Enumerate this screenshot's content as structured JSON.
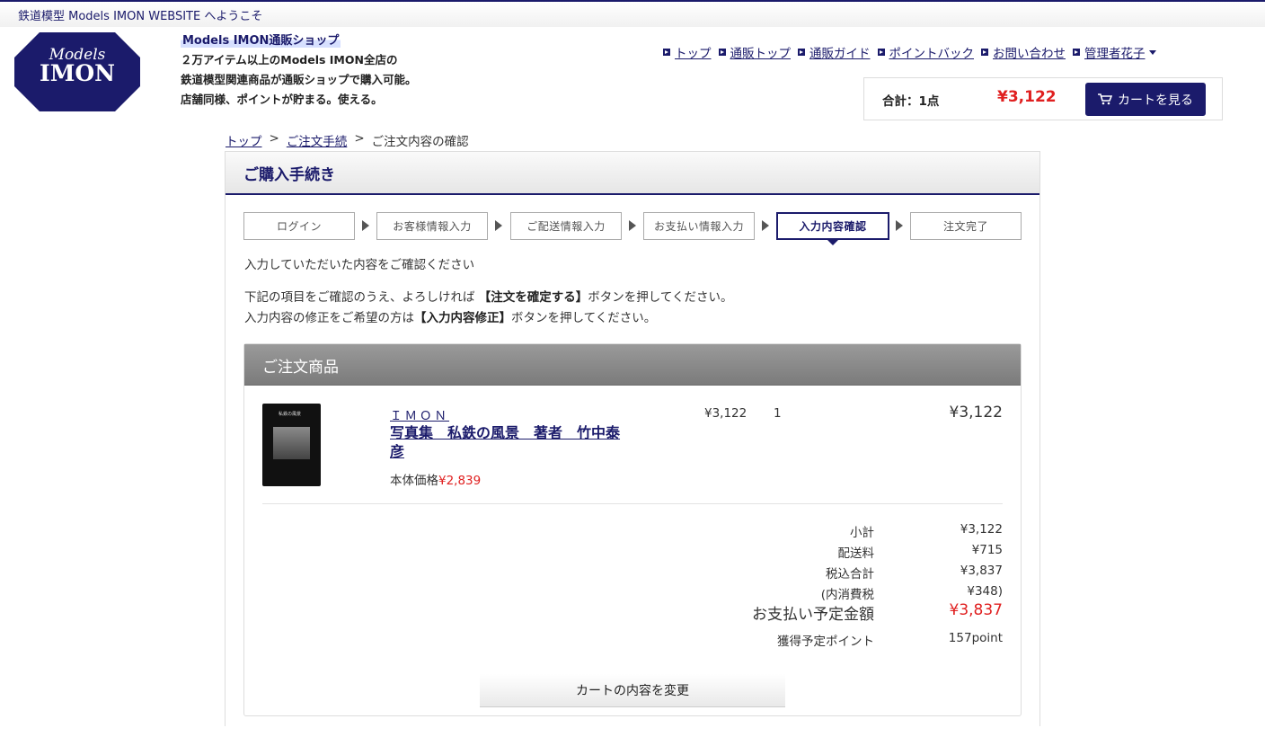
{
  "welcome": "鉄道模型 Models IMON WEBSITE へようこそ",
  "logo": {
    "top": "Models",
    "bottom": "IMON"
  },
  "shop": {
    "title": "Models IMON通販ショップ",
    "desc1": "２万アイテム以上のModels IMON全店の",
    "desc2": "鉄道模型関連商品が通販ショップで購入可能。",
    "desc3": "店舗同様、ポイントが貯まる。使える。"
  },
  "nav": [
    "トップ",
    "通販トップ",
    "通販ガイド",
    "ポイントバック",
    "お問い合わせ",
    "管理者花子"
  ],
  "cart": {
    "total_label": "合計：1点",
    "total_price": "¥3,122",
    "button": "カートを見る"
  },
  "breadcrumb": [
    "トップ",
    "ご注文手続",
    "ご注文内容の確認"
  ],
  "panel_title": "ご購入手続き",
  "steps": [
    "ログイン",
    "お客様情報入力",
    "ご配送情報入力",
    "お支払い情報入力",
    "入力内容確認",
    "注文完了"
  ],
  "messages": {
    "confirm": "入力していただいた内容をご確認ください",
    "line1_pre": "下記の項目をご確認のうえ、よろしければ ",
    "line1_bold": "【注文を確定する】",
    "line1_post": "ボタンを押してください。",
    "line2_pre": "入力内容の修正をご希望の方は",
    "line2_bold": "【入力内容修正】",
    "line2_post": "ボタンを押してください。"
  },
  "order": {
    "title": "ご注文商品",
    "brand": "ＩＭＯＮ",
    "product_name": "写真集　私鉄の風景　著者　竹中泰彦",
    "base_label": "本体価格",
    "base_price": "¥2,839",
    "unit_price": "¥3,122",
    "quantity": "1",
    "line_total": "¥3,122",
    "thumb_title": "私鉄の風景"
  },
  "summary": {
    "subtotal_label": "小計",
    "subtotal": "¥3,122",
    "shipping_label": "配送料",
    "shipping": "¥715",
    "total_label": "税込合計",
    "total": "¥3,837",
    "tax_label": "(内消費税",
    "tax": "¥348)",
    "pay_label": "お支払い予定金額",
    "pay": "¥3,837",
    "points_label": "獲得予定ポイント",
    "points": "157point"
  },
  "change_button": "カートの内容を変更"
}
